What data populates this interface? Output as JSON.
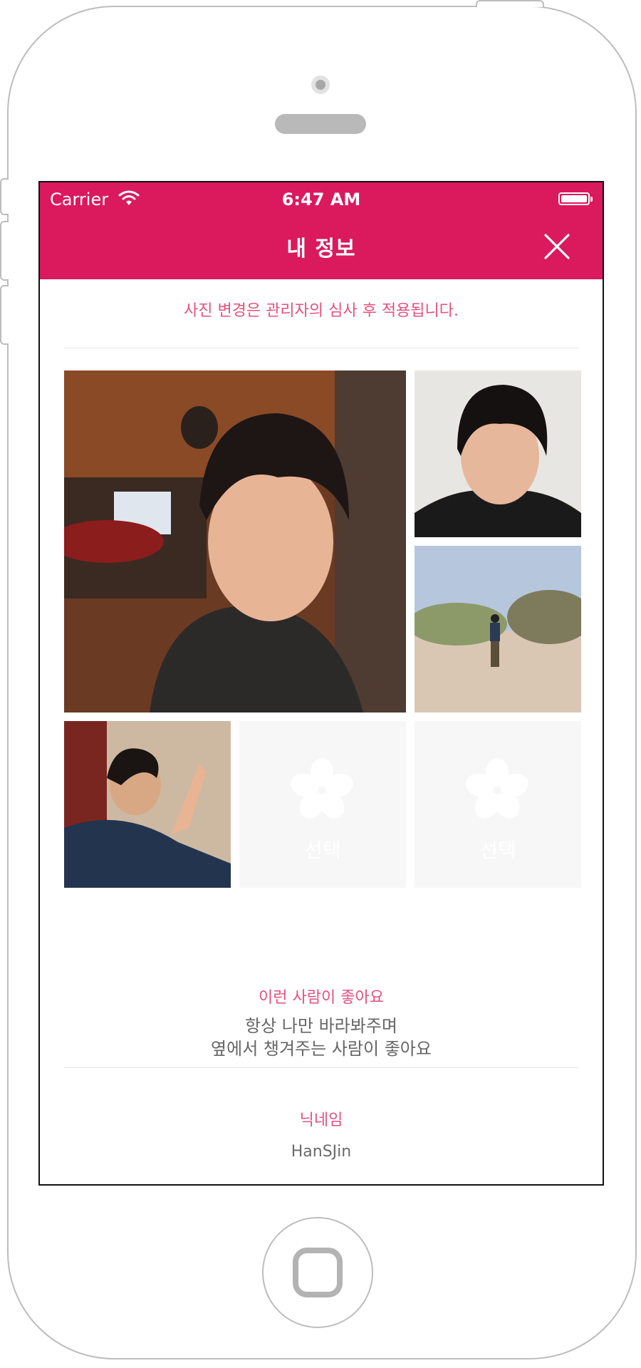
{
  "status_bar": {
    "carrier": "Carrier",
    "time": "6:47 AM"
  },
  "header": {
    "title": "내 정보"
  },
  "notice": "사진 변경은 관리자의 심사 후 적용됩니다.",
  "photos": {
    "slot_label": "선택"
  },
  "preference": {
    "label": "이런 사람이 좋아요",
    "line1": "항상 나만 바라봐주며",
    "line2": "옆에서 챙겨주는 사람이 좋아요"
  },
  "nickname": {
    "label": "닉네임",
    "value": "HanSJin"
  },
  "colors": {
    "accent": "#da1a5c",
    "label_pink": "#e4517c",
    "slot_bg": "#f7f7f7"
  }
}
